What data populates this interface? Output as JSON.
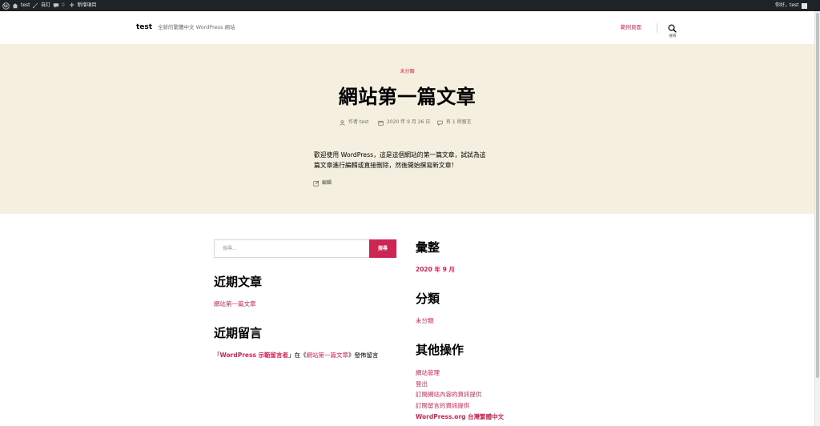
{
  "adminbar": {
    "site_name": "test",
    "customize": "自訂",
    "comments_count": "0",
    "new_content": "新增項目",
    "howdy": "你好，test"
  },
  "header": {
    "site_title": "test",
    "site_description": "全新的繁體中文 WordPress 網站",
    "menu_item": "範例頁面",
    "search_label": "搜尋"
  },
  "entry": {
    "category": "未分類",
    "title": "網站第一篇文章",
    "meta_author": "作者 test",
    "meta_date": "2020 年 9 月 26 日",
    "meta_comments": "有 1 則留言",
    "content_line1": "歡迎使用 WordPress，這是這個網站的第一篇文章，試試為這",
    "content_line2": "篇文章進行編輯或直接刪除，然後開始撰寫新文章！",
    "edit_label": "編輯"
  },
  "widgets": {
    "search_placeholder": "搜尋…",
    "search_button": "搜尋",
    "recent_posts_title": "近期文章",
    "recent_posts": [
      "網站第一篇文章"
    ],
    "recent_comments_title": "近期留言",
    "comment_open": "「",
    "comment_author": "WordPress 示範留言者",
    "comment_close": "」",
    "comment_on": "在《",
    "comment_post": "網站第一篇文章",
    "comment_end": "》發佈留言",
    "archives_title": "彙整",
    "archives": [
      "2020 年 9 月"
    ],
    "categories_title": "分類",
    "categories": [
      "未分類"
    ],
    "meta_title": "其他操作",
    "meta_links": [
      "網站管理",
      "登出",
      "訂閱網站內容的資訊提供",
      "訂閱留言的資訊提供",
      "WordPress.org 台灣繁體中文"
    ]
  },
  "colors": {
    "accent": "#cd2653",
    "hero_bg": "#f5efe0",
    "adminbar_bg": "#1d2327"
  }
}
